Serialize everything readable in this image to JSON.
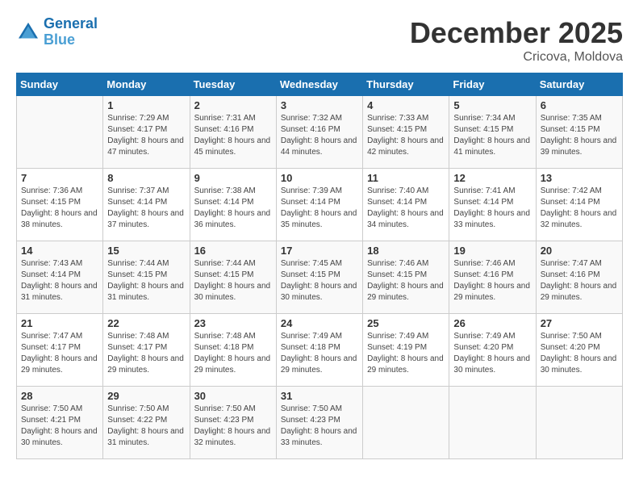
{
  "header": {
    "logo_line1": "General",
    "logo_line2": "Blue",
    "month": "December 2025",
    "location": "Cricova, Moldova"
  },
  "weekdays": [
    "Sunday",
    "Monday",
    "Tuesday",
    "Wednesday",
    "Thursday",
    "Friday",
    "Saturday"
  ],
  "weeks": [
    [
      {
        "day": "",
        "sunrise": "",
        "sunset": "",
        "daylight": ""
      },
      {
        "day": "1",
        "sunrise": "7:29 AM",
        "sunset": "4:17 PM",
        "daylight": "8 hours and 47 minutes."
      },
      {
        "day": "2",
        "sunrise": "7:31 AM",
        "sunset": "4:16 PM",
        "daylight": "8 hours and 45 minutes."
      },
      {
        "day": "3",
        "sunrise": "7:32 AM",
        "sunset": "4:16 PM",
        "daylight": "8 hours and 44 minutes."
      },
      {
        "day": "4",
        "sunrise": "7:33 AM",
        "sunset": "4:15 PM",
        "daylight": "8 hours and 42 minutes."
      },
      {
        "day": "5",
        "sunrise": "7:34 AM",
        "sunset": "4:15 PM",
        "daylight": "8 hours and 41 minutes."
      },
      {
        "day": "6",
        "sunrise": "7:35 AM",
        "sunset": "4:15 PM",
        "daylight": "8 hours and 39 minutes."
      }
    ],
    [
      {
        "day": "7",
        "sunrise": "7:36 AM",
        "sunset": "4:15 PM",
        "daylight": "8 hours and 38 minutes."
      },
      {
        "day": "8",
        "sunrise": "7:37 AM",
        "sunset": "4:14 PM",
        "daylight": "8 hours and 37 minutes."
      },
      {
        "day": "9",
        "sunrise": "7:38 AM",
        "sunset": "4:14 PM",
        "daylight": "8 hours and 36 minutes."
      },
      {
        "day": "10",
        "sunrise": "7:39 AM",
        "sunset": "4:14 PM",
        "daylight": "8 hours and 35 minutes."
      },
      {
        "day": "11",
        "sunrise": "7:40 AM",
        "sunset": "4:14 PM",
        "daylight": "8 hours and 34 minutes."
      },
      {
        "day": "12",
        "sunrise": "7:41 AM",
        "sunset": "4:14 PM",
        "daylight": "8 hours and 33 minutes."
      },
      {
        "day": "13",
        "sunrise": "7:42 AM",
        "sunset": "4:14 PM",
        "daylight": "8 hours and 32 minutes."
      }
    ],
    [
      {
        "day": "14",
        "sunrise": "7:43 AM",
        "sunset": "4:14 PM",
        "daylight": "8 hours and 31 minutes."
      },
      {
        "day": "15",
        "sunrise": "7:44 AM",
        "sunset": "4:15 PM",
        "daylight": "8 hours and 31 minutes."
      },
      {
        "day": "16",
        "sunrise": "7:44 AM",
        "sunset": "4:15 PM",
        "daylight": "8 hours and 30 minutes."
      },
      {
        "day": "17",
        "sunrise": "7:45 AM",
        "sunset": "4:15 PM",
        "daylight": "8 hours and 30 minutes."
      },
      {
        "day": "18",
        "sunrise": "7:46 AM",
        "sunset": "4:15 PM",
        "daylight": "8 hours and 29 minutes."
      },
      {
        "day": "19",
        "sunrise": "7:46 AM",
        "sunset": "4:16 PM",
        "daylight": "8 hours and 29 minutes."
      },
      {
        "day": "20",
        "sunrise": "7:47 AM",
        "sunset": "4:16 PM",
        "daylight": "8 hours and 29 minutes."
      }
    ],
    [
      {
        "day": "21",
        "sunrise": "7:47 AM",
        "sunset": "4:17 PM",
        "daylight": "8 hours and 29 minutes."
      },
      {
        "day": "22",
        "sunrise": "7:48 AM",
        "sunset": "4:17 PM",
        "daylight": "8 hours and 29 minutes."
      },
      {
        "day": "23",
        "sunrise": "7:48 AM",
        "sunset": "4:18 PM",
        "daylight": "8 hours and 29 minutes."
      },
      {
        "day": "24",
        "sunrise": "7:49 AM",
        "sunset": "4:18 PM",
        "daylight": "8 hours and 29 minutes."
      },
      {
        "day": "25",
        "sunrise": "7:49 AM",
        "sunset": "4:19 PM",
        "daylight": "8 hours and 29 minutes."
      },
      {
        "day": "26",
        "sunrise": "7:49 AM",
        "sunset": "4:20 PM",
        "daylight": "8 hours and 30 minutes."
      },
      {
        "day": "27",
        "sunrise": "7:50 AM",
        "sunset": "4:20 PM",
        "daylight": "8 hours and 30 minutes."
      }
    ],
    [
      {
        "day": "28",
        "sunrise": "7:50 AM",
        "sunset": "4:21 PM",
        "daylight": "8 hours and 30 minutes."
      },
      {
        "day": "29",
        "sunrise": "7:50 AM",
        "sunset": "4:22 PM",
        "daylight": "8 hours and 31 minutes."
      },
      {
        "day": "30",
        "sunrise": "7:50 AM",
        "sunset": "4:23 PM",
        "daylight": "8 hours and 32 minutes."
      },
      {
        "day": "31",
        "sunrise": "7:50 AM",
        "sunset": "4:23 PM",
        "daylight": "8 hours and 33 minutes."
      },
      {
        "day": "",
        "sunrise": "",
        "sunset": "",
        "daylight": ""
      },
      {
        "day": "",
        "sunrise": "",
        "sunset": "",
        "daylight": ""
      },
      {
        "day": "",
        "sunrise": "",
        "sunset": "",
        "daylight": ""
      }
    ]
  ],
  "labels": {
    "sunrise": "Sunrise:",
    "sunset": "Sunset:",
    "daylight": "Daylight:"
  }
}
